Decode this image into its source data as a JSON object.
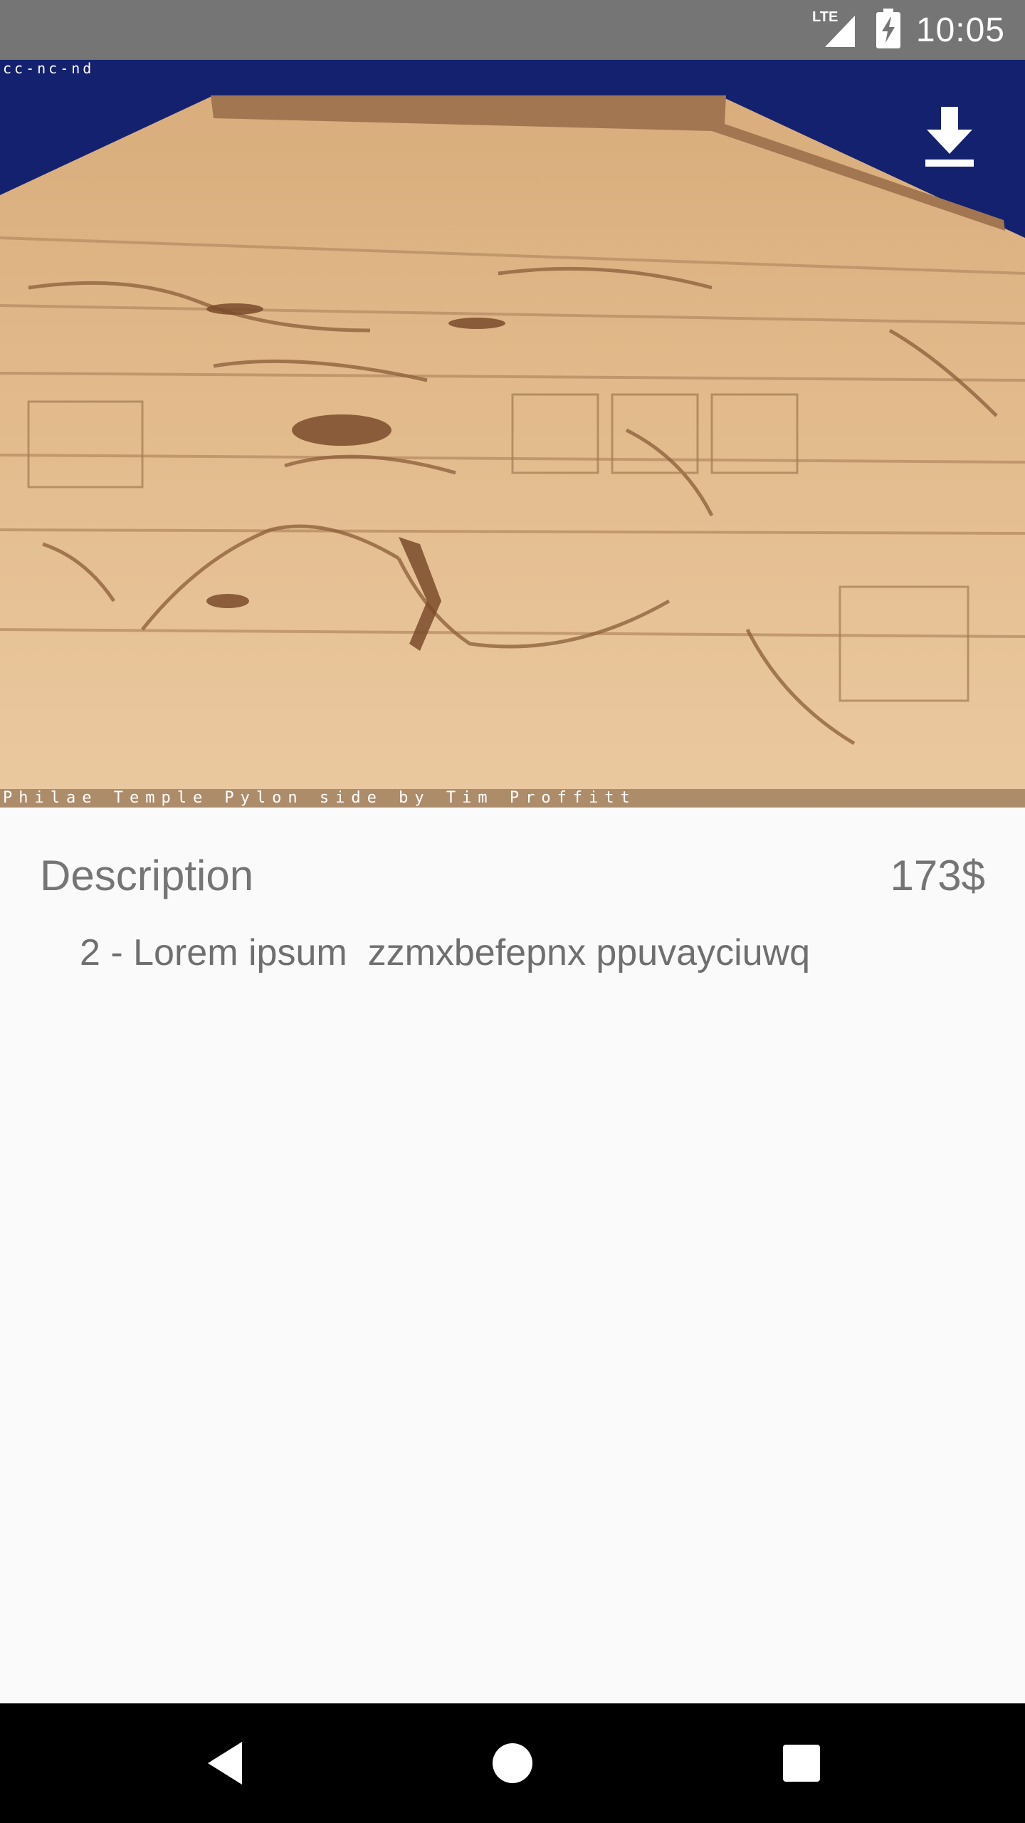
{
  "status_bar": {
    "time": "10:05",
    "network_label": "LTE",
    "signal_icon": "signal-icon",
    "battery_icon": "battery-charging-icon"
  },
  "hero": {
    "watermark_top": "cc-nc-nd",
    "watermark_bottom": "Philae Temple Pylon side by Tim Proffitt",
    "download_icon": "download-icon"
  },
  "content": {
    "description_label": "Description",
    "price": "173$",
    "description_text": "2 - Lorem ipsum  zzmxbefepnx ppuvayciuwq"
  },
  "nav_bar": {
    "back_icon": "back-icon",
    "home_icon": "home-icon",
    "recents_icon": "recents-icon"
  },
  "colors": {
    "status_bar": "#757575",
    "nav_bar": "#000000",
    "background": "#fafafa",
    "text": "#757575",
    "sky": "#1a237e",
    "stone": "#e2b98b"
  }
}
